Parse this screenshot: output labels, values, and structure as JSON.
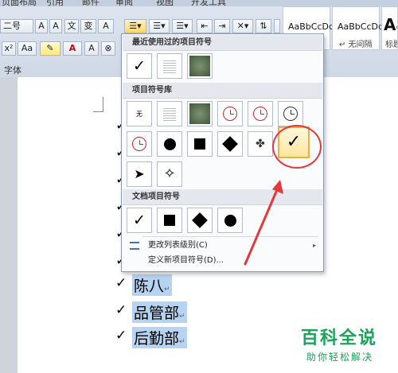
{
  "ribbon": {
    "tabs": [
      "页面布局",
      "引用",
      "邮件",
      "审阅",
      "视图",
      "开发工具"
    ],
    "font_size_value": "二号",
    "font_group_label": "字体",
    "text_buttons": {
      "format_painter": "x²",
      "clear_format": "Aa",
      "char_border": "A"
    },
    "styles": [
      {
        "sample": "AaBbCcDd",
        "name": ""
      },
      {
        "sample": "AaBbCcDd",
        "name": "↵ 无间隔"
      },
      {
        "sample": "Aa",
        "name": "标题"
      }
    ]
  },
  "dropdown": {
    "section_recent": "最近使用过的项目符号",
    "section_library": "项目符号库",
    "section_document": "文档项目符号",
    "none_label": "无",
    "menu_change_level": "更改列表级别(C)",
    "menu_define_new": "定义新项目符号(D)...",
    "menu_arrow": "▸"
  },
  "document": {
    "list_items": [
      {
        "bullet": "✓",
        "text": "陈八"
      },
      {
        "bullet": "✓",
        "text": "品管部"
      },
      {
        "bullet": "✓",
        "text": "后勤部"
      }
    ],
    "hidden_bullets": [
      "✓",
      "✓",
      "✓",
      "✓",
      "✓",
      "✓"
    ],
    "para_mark": "↵"
  },
  "watermark": {
    "title": "百科全说",
    "subtitle": "助你轻松解决"
  },
  "colors": {
    "highlight": "#b6d3f2",
    "annotation": "#e23a3a",
    "watermark": "#1aa35a",
    "selection": "#e8b04a"
  }
}
